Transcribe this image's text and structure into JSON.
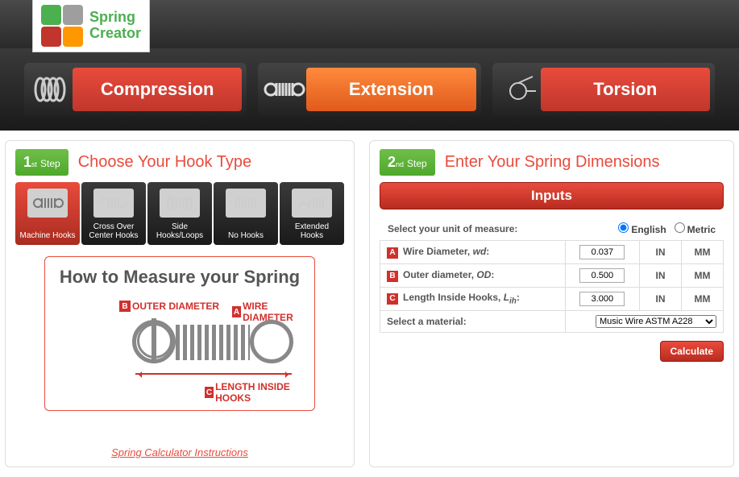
{
  "logo": {
    "line1": "Spring",
    "line2": "Creator"
  },
  "nav": [
    {
      "label": "Compression",
      "active": false
    },
    {
      "label": "Extension",
      "active": true
    },
    {
      "label": "Torsion",
      "active": false
    }
  ],
  "left": {
    "step_num": "1",
    "step_sup": "st",
    "step_word": "Step",
    "title": "Choose Your Hook Type",
    "hook_types": [
      {
        "label": "Machine Hooks",
        "active": true
      },
      {
        "label": "Cross Over Center Hooks",
        "active": false
      },
      {
        "label": "Side Hooks/Loops",
        "active": false
      },
      {
        "label": "No Hooks",
        "active": false
      },
      {
        "label": "Extended Hooks",
        "active": false
      }
    ],
    "diagram": {
      "title": "How to Measure your Spring",
      "label_a": "WIRE DIAMETER",
      "label_b": "OUTER DIAMETER",
      "label_c": "LENGTH INSIDE HOOKS"
    },
    "instructions_link": "Spring Calculator Instructions"
  },
  "right": {
    "step_num": "2",
    "step_sup": "nd",
    "step_word": "Step",
    "title": "Enter Your Spring Dimensions",
    "inputs_header": "Inputs",
    "unit_label": "Select your unit of measure:",
    "unit_english": "English",
    "unit_metric": "Metric",
    "rows": [
      {
        "letter": "A",
        "name_html": "Wire Diameter, <i>wd</i>:",
        "value": "0.037"
      },
      {
        "letter": "B",
        "name_html": "Outer diameter, <i>OD</i>:",
        "value": "0.500"
      },
      {
        "letter": "C",
        "name_html": "Length Inside Hooks, <i>L<sub>ih</sub></i>:",
        "value": "3.000"
      }
    ],
    "unit_in": "IN",
    "unit_mm": "MM",
    "material_label": "Select a material:",
    "material_value": "Music Wire ASTM A228",
    "calculate": "Calculate"
  }
}
